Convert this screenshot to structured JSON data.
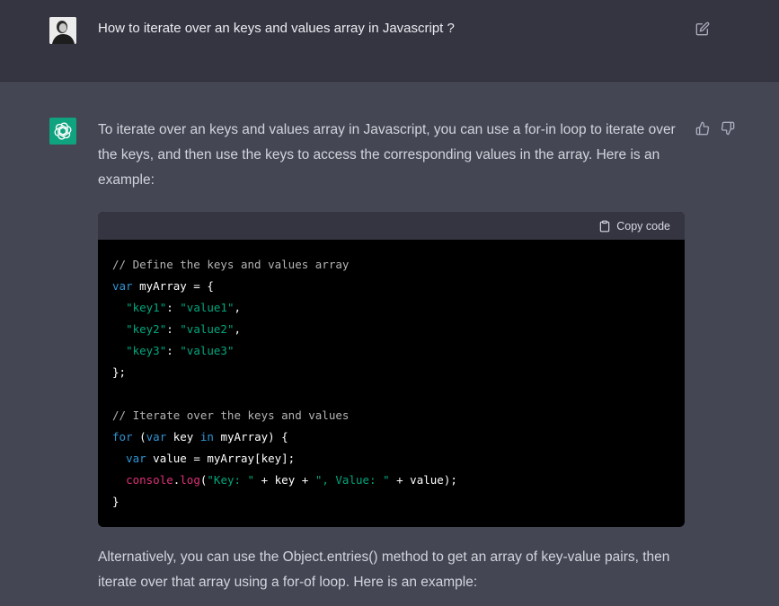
{
  "user_message": {
    "text": "How to iterate over an keys and values array in Javascript ?"
  },
  "assistant_message": {
    "intro": "To iterate over an keys and values array in Javascript, you can use a for-in loop to iterate over the keys, and then use the keys to access the corresponding values in the array. Here is an example:",
    "code_block": {
      "copy_label": "Copy code",
      "lines": [
        [
          {
            "t": "// Define the keys and values array",
            "c": "comment"
          }
        ],
        [
          {
            "t": "var",
            "c": "kw"
          },
          {
            "t": " myArray = {",
            "c": ""
          }
        ],
        [
          {
            "t": "  ",
            "c": ""
          },
          {
            "t": "\"key1\"",
            "c": "str"
          },
          {
            "t": ": ",
            "c": ""
          },
          {
            "t": "\"value1\"",
            "c": "str"
          },
          {
            "t": ",",
            "c": ""
          }
        ],
        [
          {
            "t": "  ",
            "c": ""
          },
          {
            "t": "\"key2\"",
            "c": "str"
          },
          {
            "t": ": ",
            "c": ""
          },
          {
            "t": "\"value2\"",
            "c": "str"
          },
          {
            "t": ",",
            "c": ""
          }
        ],
        [
          {
            "t": "  ",
            "c": ""
          },
          {
            "t": "\"key3\"",
            "c": "str"
          },
          {
            "t": ": ",
            "c": ""
          },
          {
            "t": "\"value3\"",
            "c": "str"
          }
        ],
        [
          {
            "t": "};",
            "c": ""
          }
        ],
        [],
        [
          {
            "t": "// Iterate over the keys and values",
            "c": "comment"
          }
        ],
        [
          {
            "t": "for",
            "c": "kw"
          },
          {
            "t": " (",
            "c": ""
          },
          {
            "t": "var",
            "c": "kw"
          },
          {
            "t": " key ",
            "c": ""
          },
          {
            "t": "in",
            "c": "kw"
          },
          {
            "t": " myArray) {",
            "c": ""
          }
        ],
        [
          {
            "t": "  ",
            "c": ""
          },
          {
            "t": "var",
            "c": "kw"
          },
          {
            "t": " value = myArray[key];",
            "c": ""
          }
        ],
        [
          {
            "t": "  ",
            "c": ""
          },
          {
            "t": "console",
            "c": "fn"
          },
          {
            "t": ".",
            "c": ""
          },
          {
            "t": "log",
            "c": "fn"
          },
          {
            "t": "(",
            "c": ""
          },
          {
            "t": "\"Key: \"",
            "c": "str"
          },
          {
            "t": " + key + ",
            "c": ""
          },
          {
            "t": "\", Value: \"",
            "c": "str"
          },
          {
            "t": " + value);",
            "c": ""
          }
        ],
        [
          {
            "t": "}",
            "c": ""
          }
        ]
      ]
    },
    "followup": "Alternatively, you can use the Object.entries() method to get an array of key-value pairs, then iterate over that array using a for-of loop. Here is an example:"
  },
  "icons": {
    "edit": "edit-icon",
    "thumbs_up": "thumbs-up-icon",
    "thumbs_down": "thumbs-down-icon",
    "copy": "clipboard-icon",
    "bot": "openai-logo-icon"
  },
  "colors": {
    "user_bg": "#343541",
    "assistant_bg": "#444654",
    "brand_green": "#10a37f",
    "code_bg": "#000000",
    "code_header_bg": "#343541"
  }
}
